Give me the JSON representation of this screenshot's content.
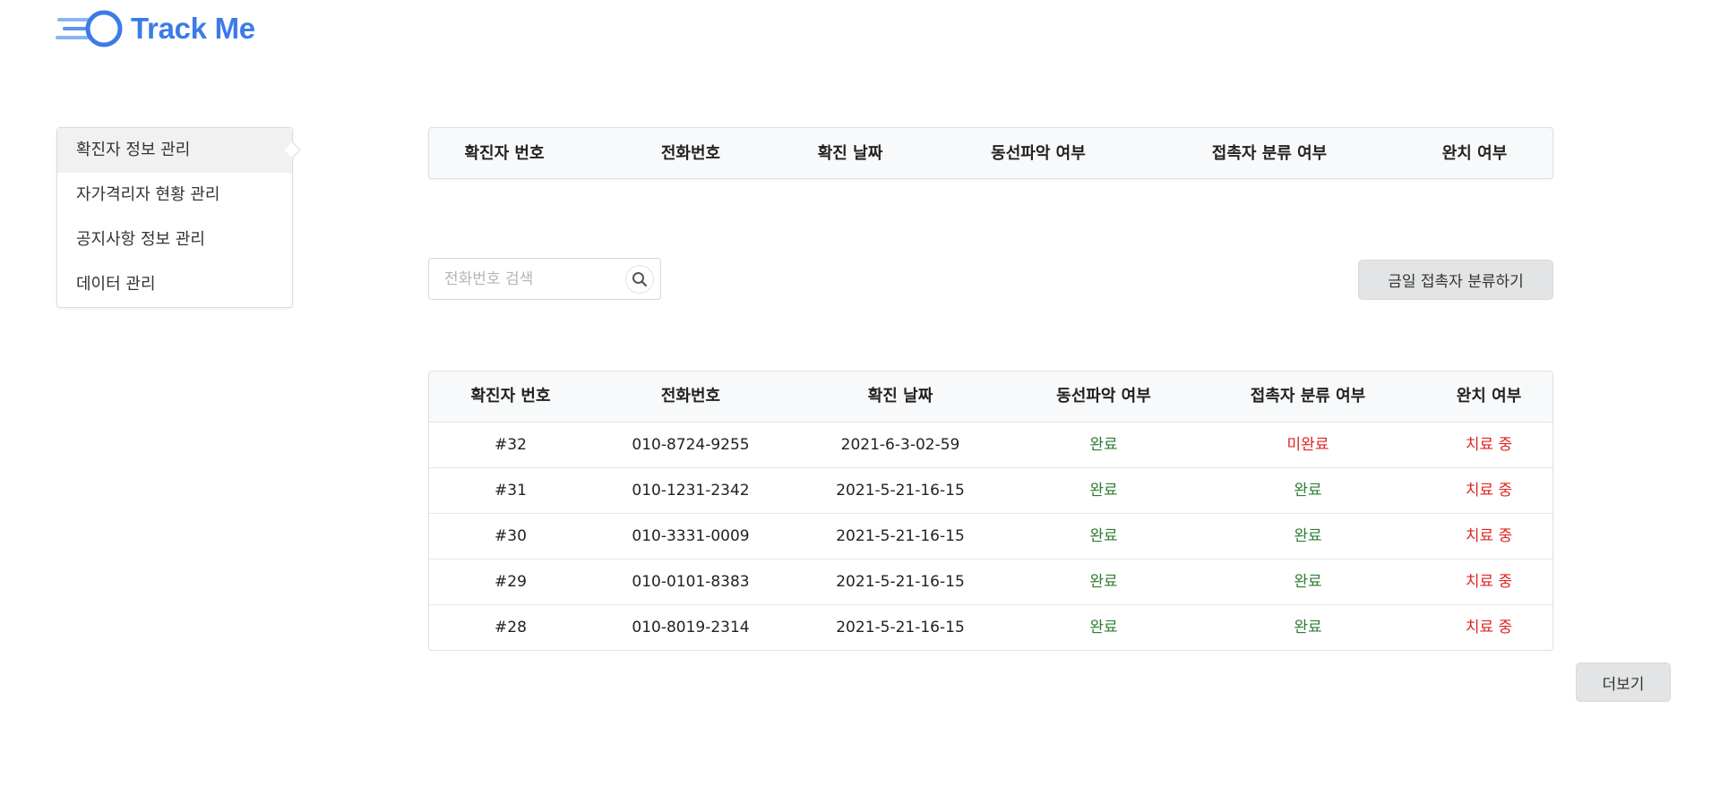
{
  "brand": {
    "name": "Track Me",
    "icon": "running-circle-logo-icon",
    "color": "#3b7be8"
  },
  "sidebar": {
    "items": [
      {
        "label": "확진자 정보 관리",
        "active": true
      },
      {
        "label": "자가격리자 현황 관리",
        "active": false
      },
      {
        "label": "공지사항 정보 관리",
        "active": false
      },
      {
        "label": "데이터 관리",
        "active": false
      }
    ]
  },
  "summary_header": {
    "columns": [
      "확진자 번호",
      "전화번호",
      "확진 날짜",
      "동선파악 여부",
      "접촉자 분류 여부",
      "완치 여부"
    ]
  },
  "search": {
    "placeholder": "전화번호 검색",
    "value": "",
    "icon": "search-icon"
  },
  "classify_button": {
    "label": "금일 접촉자 분류하기"
  },
  "table": {
    "columns": [
      "확진자 번호",
      "전화번호",
      "확진 날짜",
      "동선파악 여부",
      "접촉자 분류 여부",
      "완치 여부"
    ],
    "rows": [
      {
        "id": "#32",
        "phone": "010-8724-9255",
        "date": "2021-6-3-02-59",
        "route": "완료",
        "contact": "미완료",
        "cured": "치료 중"
      },
      {
        "id": "#31",
        "phone": "010-1231-2342",
        "date": "2021-5-21-16-15",
        "route": "완료",
        "contact": "완료",
        "cured": "치료 중"
      },
      {
        "id": "#30",
        "phone": "010-3331-0009",
        "date": "2021-5-21-16-15",
        "route": "완료",
        "contact": "완료",
        "cured": "치료 중"
      },
      {
        "id": "#29",
        "phone": "010-0101-8383",
        "date": "2021-5-21-16-15",
        "route": "완료",
        "contact": "완료",
        "cured": "치료 중"
      },
      {
        "id": "#28",
        "phone": "010-8019-2314",
        "date": "2021-5-21-16-15",
        "route": "완료",
        "contact": "완료",
        "cured": "치료 중"
      }
    ]
  },
  "more_button": {
    "label": "더보기"
  },
  "colors": {
    "complete": "#2e7d32",
    "incomplete": "#e02424"
  }
}
